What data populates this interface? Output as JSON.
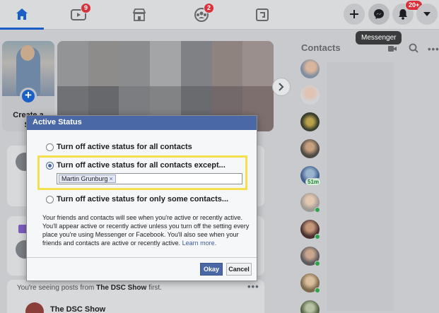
{
  "nav": {
    "watch_badge": "9",
    "groups_badge": "2",
    "notifications_badge": "20+",
    "tooltip": "Messenger"
  },
  "stories": {
    "create_label_line1": "Create a",
    "create_label_line2": "St"
  },
  "contacts": {
    "title": "Contacts",
    "minutes_badge": "51m"
  },
  "dialog": {
    "title": "Active Status",
    "option_all": "Turn off active status for all contacts",
    "option_except": "Turn off active status for all contacts except...",
    "option_some": "Turn off active status for only some contacts...",
    "tag_name": "Martin Grunburg",
    "tag_remove": "×",
    "info_text": "Your friends and contacts will see when you're active or recently active. You'll appear active or recently active unless you turn off the setting every place you're using Messenger or Facebook. You'll also see when your friends and contacts are active or recently active.",
    "learn_more": "Learn more.",
    "okay_label": "Okay",
    "cancel_label": "Cancel",
    "selected_option": "except"
  },
  "feed": {
    "seeing_prefix": "You're seeing posts from ",
    "seeing_page": "The DSC Show",
    "seeing_suffix": " first.",
    "post_author": "The DSC Show"
  },
  "colors": {
    "accent": "#1a5fc7",
    "dialog_header": "#4a67a6",
    "highlight": "#f4df4e",
    "badge": "#d8313b",
    "online": "#31a24c"
  }
}
